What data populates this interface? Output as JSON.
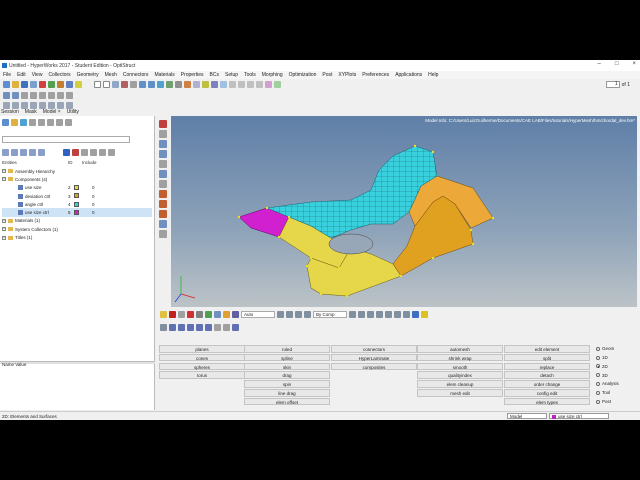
{
  "window": {
    "title": "Untitled - HyperWorks 2017 - Student Edition - OptiStruct",
    "controls": [
      "–",
      "□",
      "×"
    ]
  },
  "menubar": [
    "File",
    "Edit",
    "View",
    "Collectors",
    "Geometry",
    "Mesh",
    "Connectors",
    "Materials",
    "Properties",
    "BCs",
    "Setup",
    "Tools",
    "Morphing",
    "Optimization",
    "Post",
    "XYPlots",
    "Preferences",
    "Applications",
    "Help"
  ],
  "pager": {
    "value": "1",
    "of_label": "of 1"
  },
  "left_tabs": [
    "Session",
    "Mask",
    "Model ×",
    "Utility"
  ],
  "tree": {
    "columns": [
      "Entities",
      "ID",
      "Include"
    ],
    "rows": [
      {
        "label": "Assembly Hierarchy",
        "level": 0,
        "type": "folder"
      },
      {
        "label": "Components (4)",
        "level": 0,
        "type": "folder"
      },
      {
        "label": "use size",
        "level": 1,
        "type": "comp",
        "id": "2",
        "include": "0",
        "color": "#e6d64a"
      },
      {
        "label": "deviation ctrl",
        "level": 1,
        "type": "comp",
        "id": "3",
        "include": "0",
        "color": "#e0a020"
      },
      {
        "label": "angle ctrl",
        "level": 1,
        "type": "comp",
        "id": "4",
        "include": "0",
        "color": "#38d0dc"
      },
      {
        "label": "use size ctrl",
        "level": 1,
        "type": "comp",
        "id": "5",
        "include": "0",
        "color": "#d020d0",
        "selected": true
      },
      {
        "label": "Materials (1)",
        "level": 0,
        "type": "folder"
      },
      {
        "label": "System Collectors (1)",
        "level": 0,
        "type": "folder"
      },
      {
        "label": "Titles (1)",
        "level": 0,
        "type": "folder"
      }
    ]
  },
  "name_value_header": "Name Value",
  "model_info": "Model Info: C:/Users/LuizGuilherme/Documents/CAE LAB/Files/tutorials/HyperMesh/hm/chordal_dev.hm*",
  "toolbar2": {
    "auto_label": "Auto",
    "bycomp_label": "By Comp"
  },
  "panel": {
    "col1": [
      "planes",
      "cones",
      "spheres",
      "torus"
    ],
    "col2": [
      "ruled",
      "spline",
      "skin",
      "drag",
      "spin",
      "line drag",
      "elem offset"
    ],
    "col3": [
      "connectors",
      "HyperLaminate",
      "composites"
    ],
    "col4": [
      "automesh",
      "shrink wrap",
      "smooth",
      "qualityindex",
      "elem cleanup",
      "mesh edit"
    ],
    "col5": [
      "edit element",
      "split",
      "replace",
      "detach",
      "order change",
      "config edit",
      "elem types"
    ],
    "radios": [
      {
        "label": "Geom",
        "on": false
      },
      {
        "label": "1D",
        "on": false
      },
      {
        "label": "2D",
        "on": true
      },
      {
        "label": "3D",
        "on": false
      },
      {
        "label": "Analysis",
        "on": false
      },
      {
        "label": "Tool",
        "on": false
      },
      {
        "label": "Post",
        "on": false
      }
    ]
  },
  "status": {
    "left": "2D: Elements and Surfaces",
    "model": "Model",
    "component": "use size ctrl"
  },
  "colors": {
    "yellow": "#e6d64a",
    "orange": "#e0a020",
    "cyan": "#38d0dc",
    "magenta": "#d020d0"
  }
}
